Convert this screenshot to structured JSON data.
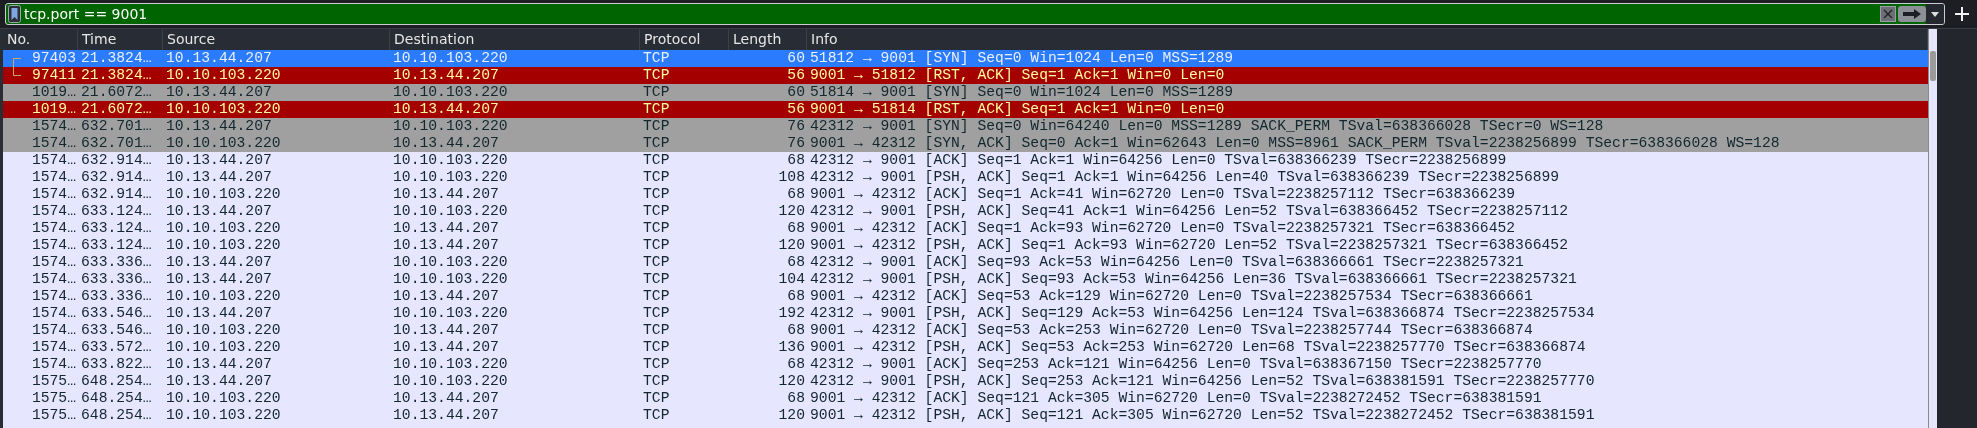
{
  "filter_bar": {
    "value": "tcp.port == 9001"
  },
  "table": {
    "columns": [
      "No.",
      "Time",
      "Source",
      "Destination",
      "Protocol",
      "Length",
      "Info"
    ],
    "rows": [
      {
        "no": "97403",
        "time": "21.3824…",
        "source": "10.13.44.207",
        "destination": "10.10.103.220",
        "protocol": "TCP",
        "length": "60",
        "info": "51812 → 9001 [SYN] Seq=0 Win=1024 Len=0 MSS=1289",
        "kind": "syn",
        "selected": true,
        "related": true
      },
      {
        "no": "97411",
        "time": "21.3824…",
        "source": "10.10.103.220",
        "destination": "10.13.44.207",
        "protocol": "TCP",
        "length": "56",
        "info": "9001 → 51812 [RST, ACK] Seq=1 Ack=1 Win=0 Len=0",
        "kind": "rst",
        "selected": false,
        "related": true
      },
      {
        "no": "1019…",
        "time": "21.6072…",
        "source": "10.13.44.207",
        "destination": "10.10.103.220",
        "protocol": "TCP",
        "length": "60",
        "info": "51814 → 9001 [SYN] Seq=0 Win=1024 Len=0 MSS=1289",
        "kind": "syn",
        "selected": false
      },
      {
        "no": "1019…",
        "time": "21.6072…",
        "source": "10.10.103.220",
        "destination": "10.13.44.207",
        "protocol": "TCP",
        "length": "56",
        "info": "9001 → 51814 [RST, ACK] Seq=1 Ack=1 Win=0 Len=0",
        "kind": "rst",
        "selected": false
      },
      {
        "no": "1574…",
        "time": "632.701…",
        "source": "10.13.44.207",
        "destination": "10.10.103.220",
        "protocol": "TCP",
        "length": "76",
        "info": "42312 → 9001 [SYN] Seq=0 Win=64240 Len=0 MSS=1289 SACK_PERM TSval=638366028 TSecr=0 WS=128",
        "kind": "syn",
        "selected": false
      },
      {
        "no": "1574…",
        "time": "632.701…",
        "source": "10.10.103.220",
        "destination": "10.13.44.207",
        "protocol": "TCP",
        "length": "76",
        "info": "9001 → 42312 [SYN, ACK] Seq=0 Ack=1 Win=62643 Len=0 MSS=8961 SACK_PERM TSval=2238256899 TSecr=638366028 WS=128",
        "kind": "syn",
        "selected": false
      },
      {
        "no": "1574…",
        "time": "632.914…",
        "source": "10.13.44.207",
        "destination": "10.10.103.220",
        "protocol": "TCP",
        "length": "68",
        "info": "42312 → 9001 [ACK] Seq=1 Ack=1 Win=64256 Len=0 TSval=638366239 TSecr=2238256899",
        "kind": "tcp",
        "selected": false
      },
      {
        "no": "1574…",
        "time": "632.914…",
        "source": "10.13.44.207",
        "destination": "10.10.103.220",
        "protocol": "TCP",
        "length": "108",
        "info": "42312 → 9001 [PSH, ACK] Seq=1 Ack=1 Win=64256 Len=40 TSval=638366239 TSecr=2238256899",
        "kind": "tcp",
        "selected": false
      },
      {
        "no": "1574…",
        "time": "632.914…",
        "source": "10.10.103.220",
        "destination": "10.13.44.207",
        "protocol": "TCP",
        "length": "68",
        "info": "9001 → 42312 [ACK] Seq=1 Ack=41 Win=62720 Len=0 TSval=2238257112 TSecr=638366239",
        "kind": "tcp",
        "selected": false
      },
      {
        "no": "1574…",
        "time": "633.124…",
        "source": "10.13.44.207",
        "destination": "10.10.103.220",
        "protocol": "TCP",
        "length": "120",
        "info": "42312 → 9001 [PSH, ACK] Seq=41 Ack=1 Win=64256 Len=52 TSval=638366452 TSecr=2238257112",
        "kind": "tcp",
        "selected": false
      },
      {
        "no": "1574…",
        "time": "633.124…",
        "source": "10.10.103.220",
        "destination": "10.13.44.207",
        "protocol": "TCP",
        "length": "68",
        "info": "9001 → 42312 [ACK] Seq=1 Ack=93 Win=62720 Len=0 TSval=2238257321 TSecr=638366452",
        "kind": "tcp",
        "selected": false
      },
      {
        "no": "1574…",
        "time": "633.124…",
        "source": "10.10.103.220",
        "destination": "10.13.44.207",
        "protocol": "TCP",
        "length": "120",
        "info": "9001 → 42312 [PSH, ACK] Seq=1 Ack=93 Win=62720 Len=52 TSval=2238257321 TSecr=638366452",
        "kind": "tcp",
        "selected": false
      },
      {
        "no": "1574…",
        "time": "633.336…",
        "source": "10.13.44.207",
        "destination": "10.10.103.220",
        "protocol": "TCP",
        "length": "68",
        "info": "42312 → 9001 [ACK] Seq=93 Ack=53 Win=64256 Len=0 TSval=638366661 TSecr=2238257321",
        "kind": "tcp",
        "selected": false
      },
      {
        "no": "1574…",
        "time": "633.336…",
        "source": "10.13.44.207",
        "destination": "10.10.103.220",
        "protocol": "TCP",
        "length": "104",
        "info": "42312 → 9001 [PSH, ACK] Seq=93 Ack=53 Win=64256 Len=36 TSval=638366661 TSecr=2238257321",
        "kind": "tcp",
        "selected": false
      },
      {
        "no": "1574…",
        "time": "633.336…",
        "source": "10.10.103.220",
        "destination": "10.13.44.207",
        "protocol": "TCP",
        "length": "68",
        "info": "9001 → 42312 [ACK] Seq=53 Ack=129 Win=62720 Len=0 TSval=2238257534 TSecr=638366661",
        "kind": "tcp",
        "selected": false
      },
      {
        "no": "1574…",
        "time": "633.546…",
        "source": "10.13.44.207",
        "destination": "10.10.103.220",
        "protocol": "TCP",
        "length": "192",
        "info": "42312 → 9001 [PSH, ACK] Seq=129 Ack=53 Win=64256 Len=124 TSval=638366874 TSecr=2238257534",
        "kind": "tcp",
        "selected": false
      },
      {
        "no": "1574…",
        "time": "633.546…",
        "source": "10.10.103.220",
        "destination": "10.13.44.207",
        "protocol": "TCP",
        "length": "68",
        "info": "9001 → 42312 [ACK] Seq=53 Ack=253 Win=62720 Len=0 TSval=2238257744 TSecr=638366874",
        "kind": "tcp",
        "selected": false
      },
      {
        "no": "1574…",
        "time": "633.572…",
        "source": "10.10.103.220",
        "destination": "10.13.44.207",
        "protocol": "TCP",
        "length": "136",
        "info": "9001 → 42312 [PSH, ACK] Seq=53 Ack=253 Win=62720 Len=68 TSval=2238257770 TSecr=638366874",
        "kind": "tcp",
        "selected": false
      },
      {
        "no": "1574…",
        "time": "633.822…",
        "source": "10.13.44.207",
        "destination": "10.10.103.220",
        "protocol": "TCP",
        "length": "68",
        "info": "42312 → 9001 [ACK] Seq=253 Ack=121 Win=64256 Len=0 TSval=638367150 TSecr=2238257770",
        "kind": "tcp",
        "selected": false
      },
      {
        "no": "1575…",
        "time": "648.254…",
        "source": "10.13.44.207",
        "destination": "10.10.103.220",
        "protocol": "TCP",
        "length": "120",
        "info": "42312 → 9001 [PSH, ACK] Seq=253 Ack=121 Win=64256 Len=52 TSval=638381591 TSecr=2238257770",
        "kind": "tcp",
        "selected": false
      },
      {
        "no": "1575…",
        "time": "648.254…",
        "source": "10.10.103.220",
        "destination": "10.13.44.207",
        "protocol": "TCP",
        "length": "68",
        "info": "9001 → 42312 [ACK] Seq=121 Ack=305 Win=62720 Len=0 TSval=2238272452 TSecr=638381591",
        "kind": "tcp",
        "selected": false
      },
      {
        "no": "1575…",
        "time": "648.254…",
        "source": "10.10.103.220",
        "destination": "10.13.44.207",
        "protocol": "TCP",
        "length": "120",
        "info": "9001 → 42312 [PSH, ACK] Seq=121 Ack=305 Win=62720 Len=52 TSval=2238272452 TSecr=638381591",
        "kind": "tcp",
        "selected": false
      }
    ]
  }
}
